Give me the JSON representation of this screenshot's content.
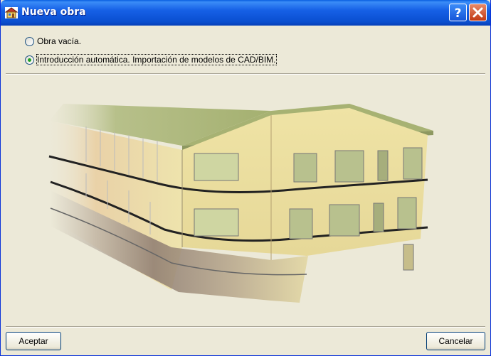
{
  "window": {
    "title": "Nueva obra",
    "icon": "house-icon"
  },
  "titlebar_buttons": {
    "help_icon": "help-icon",
    "close_icon": "close-icon"
  },
  "options": [
    {
      "label": "Obra vacía.",
      "selected": false
    },
    {
      "label": "Introducción automática. Importación de modelos de CAD/BIM.",
      "selected": true
    }
  ],
  "preview": {
    "icon": "building-3d-model-icon"
  },
  "buttons": {
    "accept": "Aceptar",
    "cancel": "Cancelar"
  },
  "colors": {
    "titlebar": "#0a5fe0",
    "selected_radio": "#21a121",
    "background": "#ece9d8"
  }
}
